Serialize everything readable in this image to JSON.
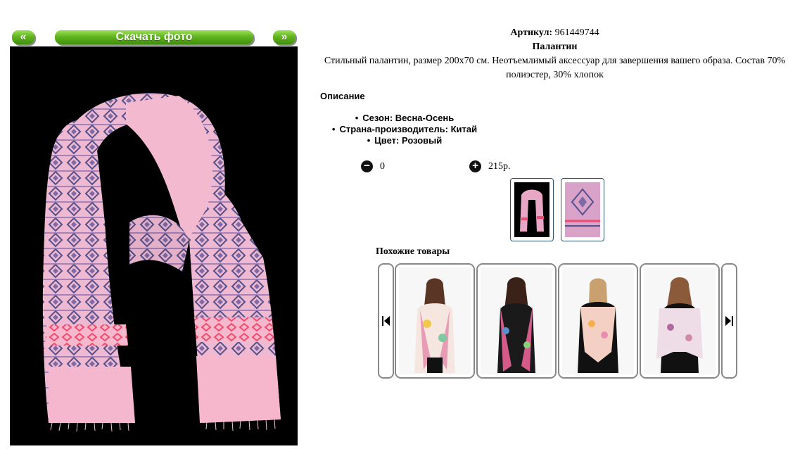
{
  "gallery": {
    "prev_label": "«",
    "download_label": "Скачать фото",
    "next_label": "»"
  },
  "product": {
    "sku_label": "Артикул:",
    "sku": "961449744",
    "name": "Палантин",
    "description": "Стильный палантин, размер 200х70 см. Неотъемлимый аксессуар для завершения вашего образа. Состав 70% полиэстер, 30% хлопок",
    "desc_heading": "Описание",
    "attributes": [
      "Сезон: Весна-Осень",
      "Страна-производитель: Китай",
      "Цвет: Розовый"
    ]
  },
  "cart": {
    "quantity": "0",
    "price": "215р."
  },
  "similar": {
    "heading": "Похожие товары"
  },
  "colors": {
    "button_green": "#62b61e",
    "scarf_pink": "#f3b8cf",
    "pattern_navy": "#55508a",
    "pattern_red": "#f04a6e",
    "photo_bg": "#000000"
  }
}
